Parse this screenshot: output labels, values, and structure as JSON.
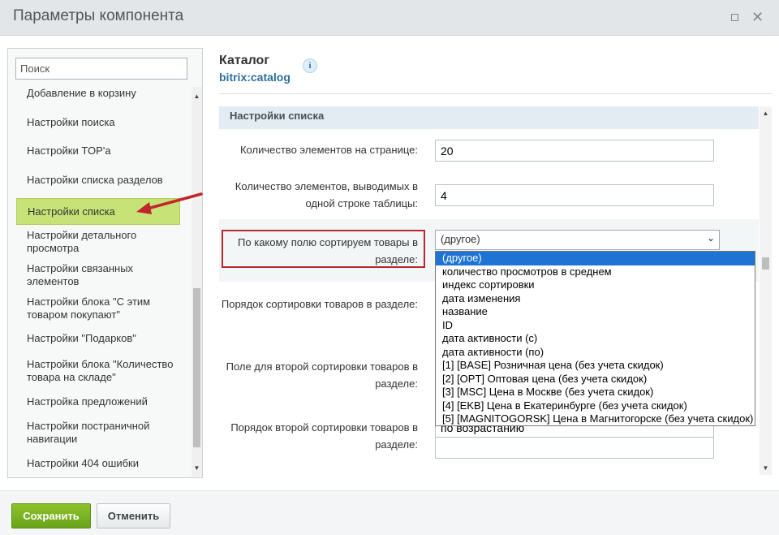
{
  "window": {
    "title": "Параметры компонента"
  },
  "search": {
    "placeholder": "Поиск"
  },
  "sidebar": {
    "items": [
      {
        "label": "Добавление в корзину"
      },
      {
        "label": "Настройки поиска"
      },
      {
        "label": "Настройки TOP'а"
      },
      {
        "label": "Настройки списка разделов"
      },
      {
        "label": "Настройки списка"
      },
      {
        "label": "Настройки детального просмотра"
      },
      {
        "label": "Настройки связанных элементов"
      },
      {
        "label": "Настройки блока \"С этим товаром покупают\""
      },
      {
        "label": "Настройки \"Подарков\""
      },
      {
        "label": "Настройки блока \"Количество товара на складе\""
      },
      {
        "label": "Настройка предложений"
      },
      {
        "label": "Настройки постраничной навигации"
      },
      {
        "label": "Настройки 404 ошибки"
      }
    ],
    "active_index": 4
  },
  "component": {
    "title": "Каталог",
    "code": "bitrix:catalog",
    "info_icon": "i"
  },
  "section": {
    "title": "Настройки списка"
  },
  "fields": {
    "page_count": {
      "label": "Количество элементов на странице:",
      "value": "20"
    },
    "line_count": {
      "label": "Количество элементов, выводимых в одной строке таблицы:",
      "value": "4"
    },
    "sort_field": {
      "label": "По какому полю сортируем товары в разделе:",
      "value": "(другое)"
    },
    "sort_order": {
      "label": "Порядок сортировки товаров в разделе:"
    },
    "sort_field2": {
      "label": "Поле для второй сортировки товаров в разделе:"
    },
    "sort_order2": {
      "label": "Порядок второй сортировки товаров в разделе:",
      "value": "по возрастанию"
    }
  },
  "dropdown": {
    "options": [
      "(другое)",
      "количество просмотров в среднем",
      "индекс сортировки",
      "дата изменения",
      "название",
      "ID",
      "дата активности (с)",
      "дата активности (по)",
      "[1] [BASE] Розничная цена (без учета скидок)",
      "[2] [OPT] Оптовая цена (без учета скидок)",
      "[3] [MSC] Цена в Москве (без учета скидок)",
      "[4] [EKB] Цена в Екатеринбурге (без учета скидок)",
      "[5] [MAGNITOGORSK] Цена в Магнитогорске (без учета скидок)"
    ],
    "selected_index": 0
  },
  "footer": {
    "save_label": "Сохранить",
    "cancel_label": "Отменить"
  },
  "colors": {
    "accent_green": "#7ab526",
    "active_item": "#c7e276",
    "highlight_red": "#b8272e",
    "select_blue": "#1e73d4"
  },
  "icons": {
    "close": "close-icon",
    "maximize": "maximize-icon",
    "info": "info-icon",
    "chevron": "chevron-down-icon"
  }
}
